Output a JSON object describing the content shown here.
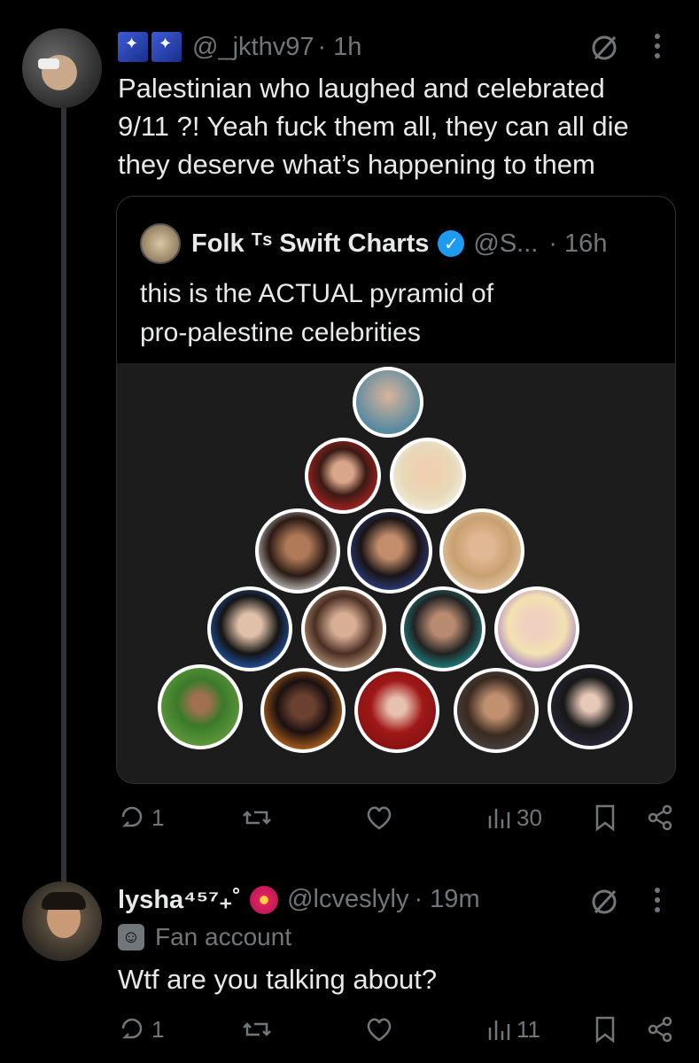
{
  "tweet1": {
    "handle": "@_jkthv97",
    "time": "· 1h",
    "text_line1": "Palestinian who laughed and celebrated",
    "text_line2": "9/11 ?! Yeah fuck them all, they can all die",
    "text_line3": "they deserve what’s happening to them",
    "quote": {
      "name": "Folk ᵀˢ Swift Charts",
      "handle": "@S...",
      "time": "· 16h",
      "text_line1": "this is the ACTUAL pyramid of",
      "text_line2": "pro-palestine celebrities"
    },
    "replies": "1",
    "views": "30"
  },
  "tweet2": {
    "name": "lysha⁴⁵⁷₊˚",
    "handle": "@lcveslyly",
    "time": "· 19m",
    "label": "Fan account",
    "text": "Wtf are you talking about?",
    "replies": "1",
    "views": "11"
  },
  "icons": [
    "grok-icon",
    "more-icon",
    "reply-icon",
    "retweet-icon",
    "like-icon",
    "views-icon",
    "bookmark-icon",
    "share-icon",
    "verified-icon",
    "mask-icon",
    "flower-icon"
  ],
  "colors": {
    "background": "#000000",
    "text": "#e7e9ea",
    "muted": "#71767b",
    "verified": "#1d9bf0"
  }
}
